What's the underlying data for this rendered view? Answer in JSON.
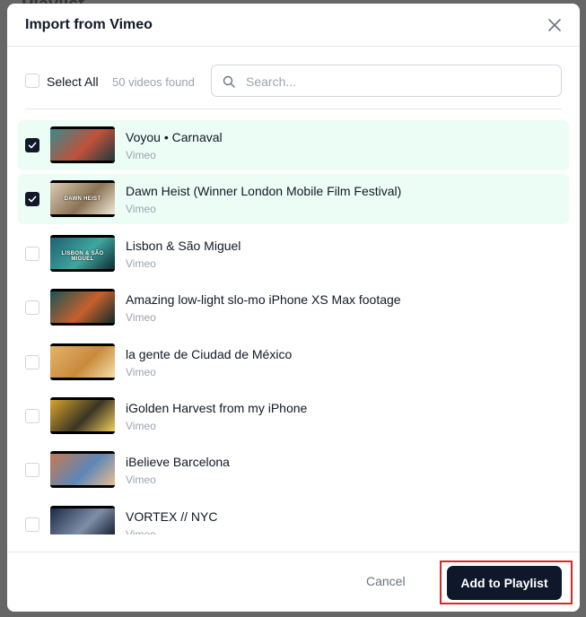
{
  "background": {
    "title": "Playlist"
  },
  "dialog": {
    "title": "Import from Vimeo"
  },
  "toolbar": {
    "select_all_label": "Select All",
    "count_text": "50 videos found",
    "search_placeholder": "Search..."
  },
  "videos": [
    {
      "title": "Voyou • Carnaval",
      "source": "Vimeo",
      "checked": true,
      "thumb_colors": [
        "#3a8a8a",
        "#c0513b",
        "#1f3a3a"
      ]
    },
    {
      "title": "Dawn Heist (Winner London Mobile Film Festival)",
      "source": "Vimeo",
      "checked": true,
      "thumb_colors": [
        "#d9cbb1",
        "#8a7255",
        "#f2ead8"
      ],
      "thumb_text": "DAWN HEIST"
    },
    {
      "title": "Lisbon & São Miguel",
      "source": "Vimeo",
      "checked": false,
      "thumb_colors": [
        "#1f5f6f",
        "#3fa7a0",
        "#0e2c33"
      ],
      "thumb_text": "LISBON & SÃO MIGUEL"
    },
    {
      "title": "Amazing low-light slo-mo iPhone XS Max footage",
      "source": "Vimeo",
      "checked": false,
      "thumb_colors": [
        "#1b5454",
        "#c7602c",
        "#0f2b2b"
      ]
    },
    {
      "title": "la gente de Ciudad de México",
      "source": "Vimeo",
      "checked": false,
      "thumb_colors": [
        "#e2b36b",
        "#c98a3b",
        "#f6dfa8"
      ]
    },
    {
      "title": "iGolden Harvest from my iPhone",
      "source": "Vimeo",
      "checked": false,
      "thumb_colors": [
        "#d8a52a",
        "#3a3524",
        "#f3cf5c"
      ]
    },
    {
      "title": "iBelieve Barcelona",
      "source": "Vimeo",
      "checked": false,
      "thumb_colors": [
        "#c57a52",
        "#5d87b8",
        "#e9bd8f"
      ]
    },
    {
      "title": "VORTEX // NYC",
      "source": "Vimeo",
      "checked": false,
      "thumb_colors": [
        "#1d2a44",
        "#7f8ea8",
        "#0c1322"
      ]
    }
  ],
  "footer": {
    "cancel_label": "Cancel",
    "add_label": "Add to Playlist"
  },
  "colors": {
    "selected_row": "#ecfdf5",
    "primary": "#0f172a",
    "highlight": "#dc2626"
  }
}
